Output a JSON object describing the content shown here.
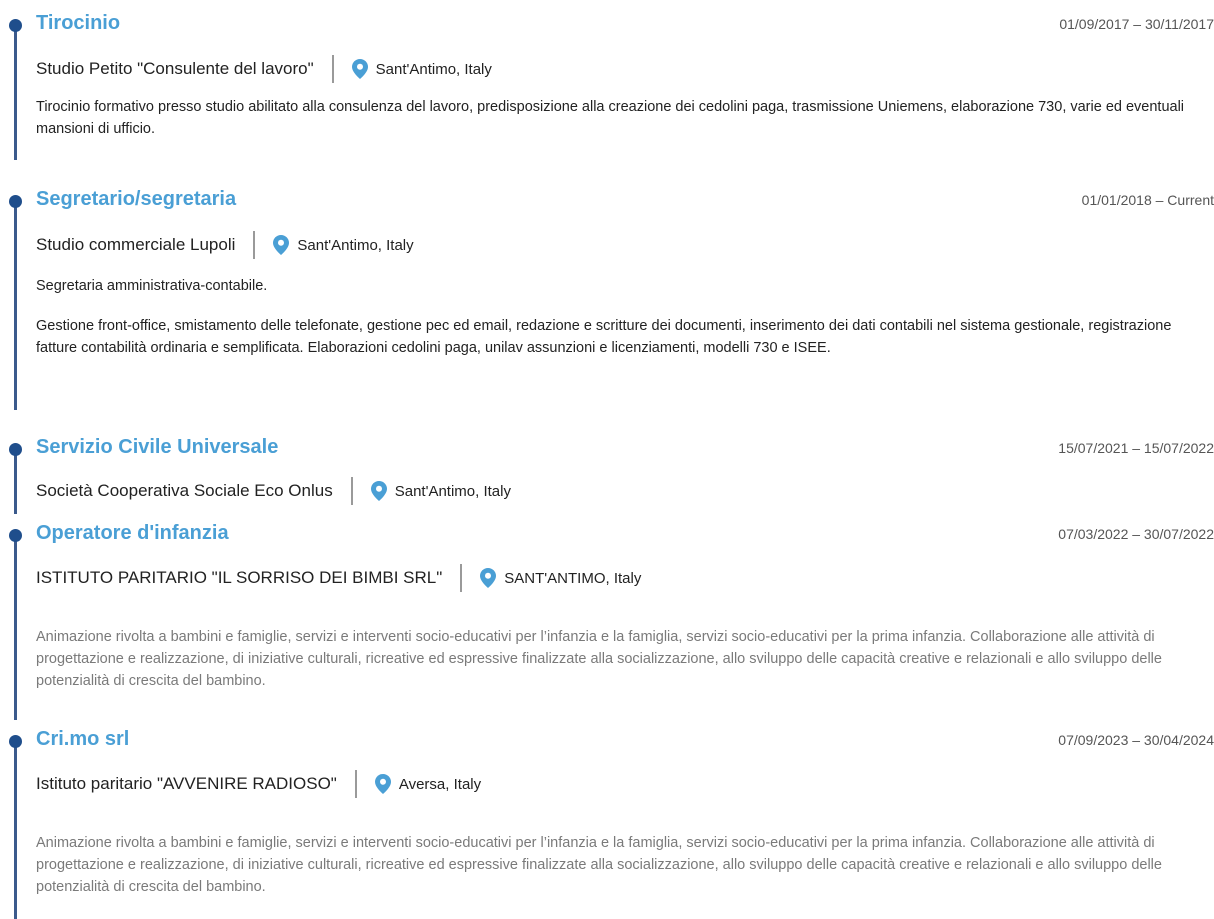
{
  "entries": [
    {
      "title": "Tirocinio",
      "date": "01/09/2017 – 30/11/2017",
      "organization": "Studio Petito \"Consulente del lavoro\"",
      "location": "Sant'Antimo, Italy",
      "descriptions": [
        "Tirocinio formativo presso studio abilitato alla consulenza del lavoro, predisposizione alla creazione dei cedolini paga, trasmissione Uniemens, elaborazione 730, varie ed eventuali mansioni di ufficio."
      ]
    },
    {
      "title": "Segretario/segretaria",
      "date": "01/01/2018 – Current",
      "organization": "Studio commerciale Lupoli",
      "location": "Sant'Antimo, Italy",
      "descriptions": [
        "Segretaria amministrativa-contabile.",
        "Gestione front-office, smistamento delle telefonate, gestione pec ed email, redazione e scritture dei documenti, inserimento dei dati contabili nel sistema gestionale, registrazione fatture contabilità ordinaria e semplificata. Elaborazioni cedolini paga, unilav assunzioni e licenziamenti, modelli 730 e ISEE."
      ]
    },
    {
      "title": "Servizio Civile Universale",
      "date": "15/07/2021 – 15/07/2022",
      "organization": "Società Cooperativa Sociale Eco Onlus",
      "location": "Sant'Antimo, Italy",
      "descriptions": []
    },
    {
      "title": "Operatore d'infanzia",
      "date": "07/03/2022 – 30/07/2022",
      "organization": "ISTITUTO PARITARIO \"IL SORRISO DEI BIMBI SRL\"",
      "location": "SANT'ANTIMO, Italy",
      "descriptions": [
        "Animazione rivolta a bambini e famiglie, servizi e interventi socio-educativi per l’infanzia e la famiglia, servizi socio-educativi per la prima infanzia. Collaborazione alle attività di progettazione e realizzazione, di iniziative culturali, ricreative ed espressive finalizzate alla socializzazione, allo sviluppo delle capacità creative e relazionali e allo sviluppo delle potenzialità di crescita del bambino."
      ]
    },
    {
      "title": "Cri.mo srl",
      "date": "07/09/2023 – 30/04/2024",
      "organization": "Istituto paritario \"AVVENIRE RADIOSO\"",
      "location": "Aversa, Italy",
      "descriptions": [
        "Animazione rivolta a bambini e famiglie, servizi e interventi socio-educativi per l’infanzia e la famiglia, servizi socio-educativi per la prima infanzia. Collaborazione alle attività di progettazione e realizzazione, di iniziative culturali, ricreative ed espressive finalizzate alla socializzazione, allo sviluppo delle capacità creative e relazionali e allo sviluppo delle potenzialità di crescita del bambino."
      ]
    }
  ],
  "icons": {
    "location": "location-pin-icon"
  },
  "colors": {
    "title": "#4a9fd5",
    "timeline": "#3b5a8c",
    "dot": "#1f4e8c",
    "pin": "#4a9fd5",
    "muted_text": "#7a7a7a"
  }
}
